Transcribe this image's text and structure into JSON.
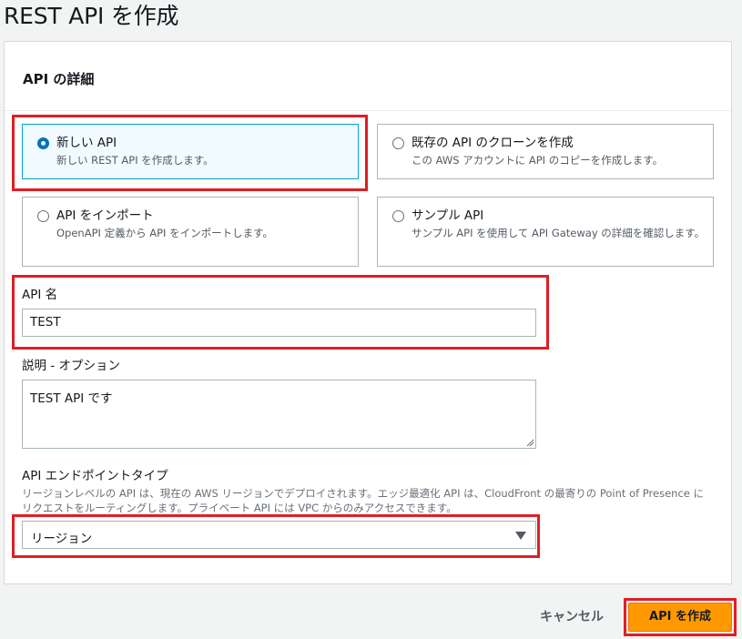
{
  "page": {
    "title": "REST API を作成"
  },
  "panel": {
    "title": "API の詳細"
  },
  "options": [
    {
      "title": "新しい API",
      "description": "新しい REST API を作成します。",
      "selected": true
    },
    {
      "title": "既存の API のクローンを作成",
      "description": "この AWS アカウントに API のコピーを作成します。",
      "selected": false
    },
    {
      "title": "API をインポート",
      "description": "OpenAPI 定義から API をインポートします。",
      "selected": false
    },
    {
      "title": "サンプル API",
      "description": "サンプル API を使用して API Gateway の詳細を確認します。",
      "selected": false
    }
  ],
  "api_name": {
    "label": "API 名",
    "value": "TEST"
  },
  "description": {
    "label": "説明 - オプション",
    "value": "TEST API です"
  },
  "endpoint": {
    "label": "API エンドポイントタイプ",
    "hint": "リージョンレベルの API は、現在の AWS リージョンでデプロイされます。エッジ最適化 API は、CloudFront の最寄りの Point of Presence にリクエストをルーティングします。プライベート API には VPC からのみアクセスできます。",
    "selected": "リージョン"
  },
  "actions": {
    "cancel": "キャンセル",
    "create": "API を作成"
  },
  "colors": {
    "highlight": "#e01e25",
    "primary": "#ff9900",
    "selected_border": "#00a1c9",
    "radio": "#0073bb"
  }
}
